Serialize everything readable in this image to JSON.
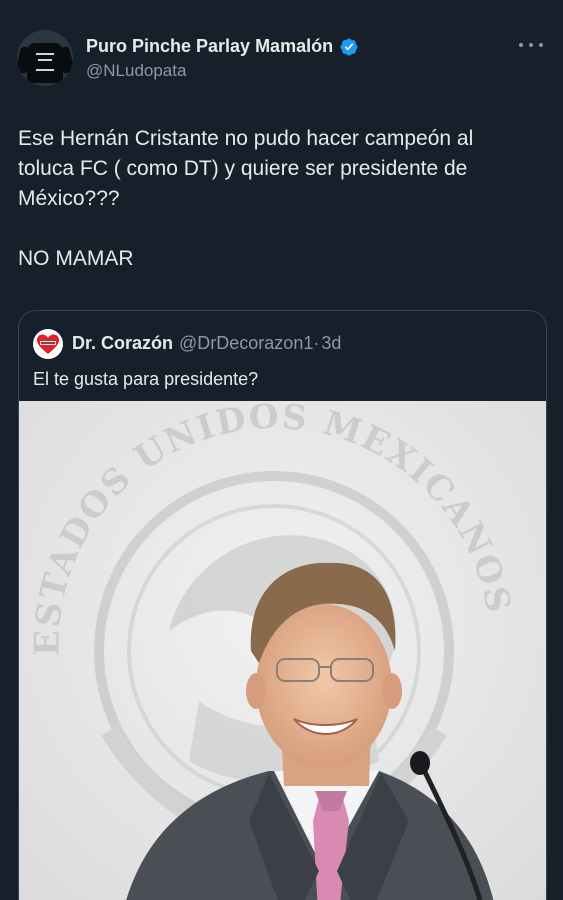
{
  "tweet": {
    "display_name": "Puro Pinche Parlay Mamalón",
    "handle": "@NLudopata",
    "text": "Ese Hernán Cristante no pudo hacer campeón al\ntoluca FC ( como DT) y quiere ser presidente de\nMéxico???\n\nNO MAMAR",
    "verified_color": "#1d9bf0",
    "more_icon": "more-dots-icon"
  },
  "quote": {
    "display_name": "Dr. Corazón",
    "handle": "@DrDecorazon1",
    "separator": "·",
    "time": "3d",
    "text": "El te gusta para presidente?",
    "image_seal_text": "ESTADOS UNIDOS MEXICANOS"
  },
  "colors": {
    "background": "#15202b",
    "text": "#e7e9ea",
    "secondary_text": "#8b98a5",
    "border": "#38444d"
  }
}
